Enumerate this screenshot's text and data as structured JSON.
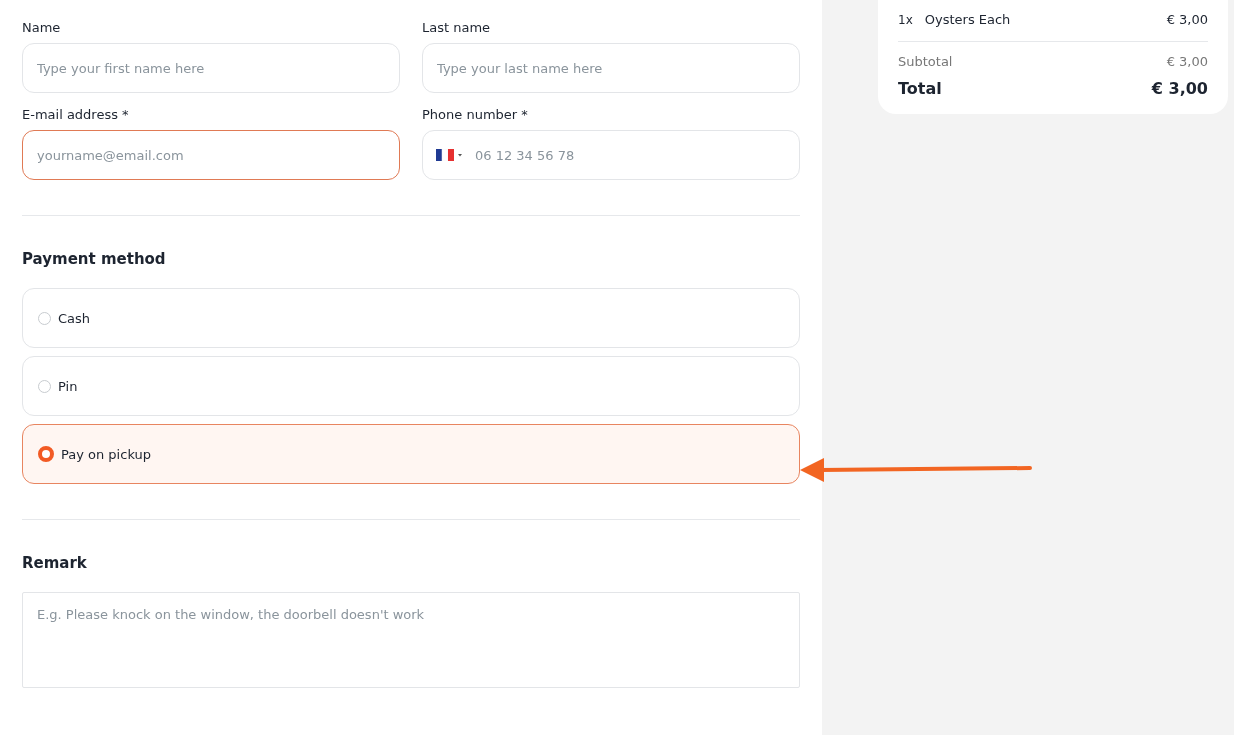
{
  "contact_fields": [
    {
      "label": "Name",
      "placeholder": "Type your first name here",
      "kind": "text",
      "error": false
    },
    {
      "label": "Last name",
      "placeholder": "Type your last name here",
      "kind": "text",
      "error": false
    },
    {
      "label": "E-mail address *",
      "placeholder": "yourname@email.com",
      "kind": "text",
      "error": true
    },
    {
      "label": "Phone number *",
      "placeholder": "06 12 34 56 78",
      "kind": "phone",
      "error": false
    }
  ],
  "payment": {
    "title": "Payment method",
    "options": [
      {
        "label": "Cash",
        "selected": false
      },
      {
        "label": "Pin",
        "selected": false
      },
      {
        "label": "Pay on pickup",
        "selected": true
      }
    ]
  },
  "remark": {
    "title": "Remark",
    "placeholder": "E.g. Please knock on the window, the doorbell doesn't work"
  },
  "order_summary": {
    "items": [
      {
        "quantity": "1x",
        "name": "Oysters Each",
        "price": "€ 3,00"
      }
    ],
    "subtotal_label": "Subtotal",
    "subtotal": "€ 3,00",
    "total_label": "Total",
    "total": "€ 3,00"
  }
}
